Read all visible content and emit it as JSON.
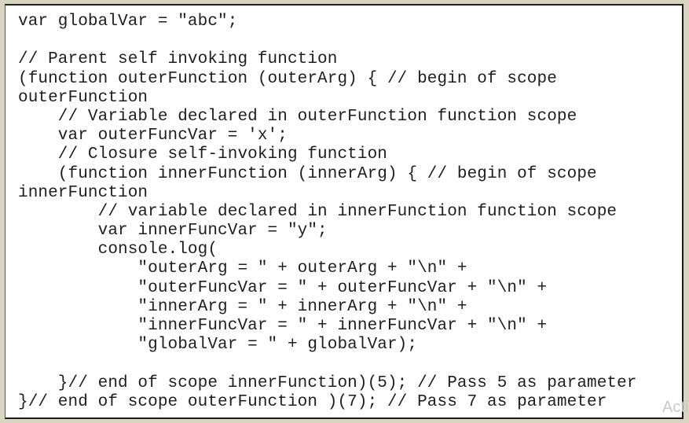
{
  "code_lines": [
    "var globalVar = \"abc\";",
    "",
    "// Parent self invoking function",
    "(function outerFunction (outerArg) { // begin of scope",
    "outerFunction",
    "    // Variable declared in outerFunction function scope",
    "    var outerFuncVar = 'x';",
    "    // Closure self-invoking function",
    "    (function innerFunction (innerArg) { // begin of scope",
    "innerFunction",
    "        // variable declared in innerFunction function scope",
    "        var innerFuncVar = \"y\";",
    "        console.log(",
    "            \"outerArg = \" + outerArg + \"\\n\" +",
    "            \"outerFuncVar = \" + outerFuncVar + \"\\n\" +",
    "            \"innerArg = \" + innerArg + \"\\n\" +",
    "            \"innerFuncVar = \" + innerFuncVar + \"\\n\" +",
    "            \"globalVar = \" + globalVar);",
    "",
    "    }// end of scope innerFunction)(5); // Pass 5 as parameter",
    "}// end of scope outerFunction )(7); // Pass 7 as parameter"
  ],
  "watermark": "Acti"
}
